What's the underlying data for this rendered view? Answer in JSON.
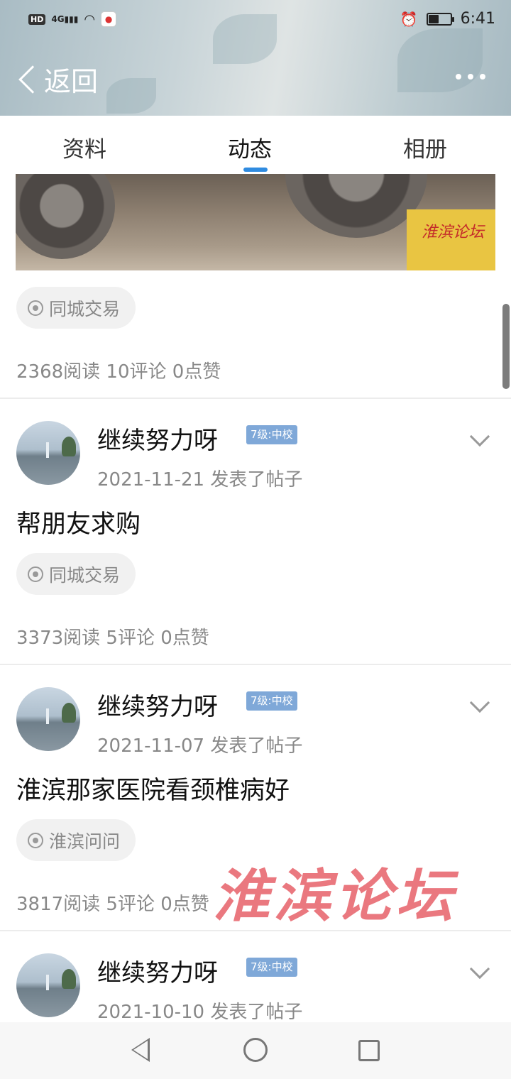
{
  "status_bar": {
    "hd": "HD",
    "network": "4G",
    "time": "6:41",
    "battery_level": 0.45
  },
  "header": {
    "back_label": "返回",
    "more_icon": "more-dots-icon"
  },
  "tabs": [
    {
      "label": "资料"
    },
    {
      "label": "动态"
    },
    {
      "label": "相册"
    }
  ],
  "active_tab": "动态",
  "posts": [
    {
      "tag": "同城交易",
      "stats": "2368阅读 10评论 0点赞",
      "photo_watermark": "淮滨论坛"
    },
    {
      "username": "继续努力呀",
      "level": "7级:中校",
      "meta": "2021-11-21 发表了帖子",
      "title": "帮朋友求购",
      "tag": "同城交易",
      "stats": "3373阅读 5评论 0点赞"
    },
    {
      "username": "继续努力呀",
      "level": "7级:中校",
      "meta": "2021-11-07 发表了帖子",
      "title": "淮滨那家医院看颈椎病好",
      "tag": "淮滨问问",
      "stats": "3817阅读 5评论 0点赞"
    },
    {
      "username": "继续努力呀",
      "level": "7级:中校",
      "meta": "2021-10-10 发表了帖子"
    }
  ],
  "watermark": "淮滨论坛",
  "colors": {
    "accent": "#2f8be0",
    "level_badge": "#7fa8d8",
    "watermark": "#e86a72"
  }
}
